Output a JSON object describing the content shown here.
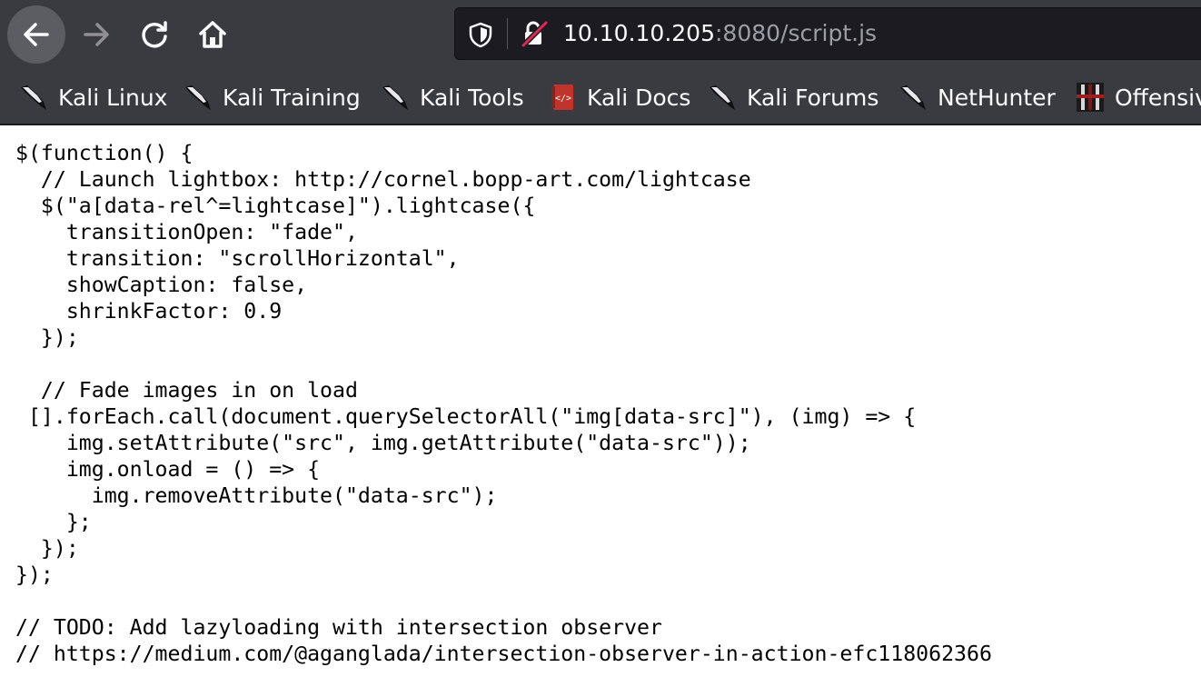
{
  "browser": {
    "url": {
      "host": "10.10.10.205",
      "rest": ":8080/script.js"
    },
    "icons": {
      "back": "arrow-left-icon",
      "forward": "arrow-right-icon",
      "reload": "reload-icon",
      "home": "home-icon",
      "tracking": "shield-icon",
      "insecure": "insecure-lock-icon"
    }
  },
  "bookmarks": [
    {
      "label": "Kali Linux",
      "icon": "kali-dragon-icon"
    },
    {
      "label": "Kali Training",
      "icon": "kali-dragon-icon"
    },
    {
      "label": "Kali Tools",
      "icon": "kali-dragon-icon"
    },
    {
      "label": "Kali Docs",
      "icon": "kali-docs-icon"
    },
    {
      "label": "Kali Forums",
      "icon": "kali-dragon-icon"
    },
    {
      "label": "NetHunter",
      "icon": "kali-dragon-icon"
    },
    {
      "label": "Offensive Security",
      "icon": "offsec-icon"
    }
  ],
  "code_lines": [
    "$(function() {",
    "  // Launch lightbox: http://cornel.bopp-art.com/lightcase",
    "  $(\"a[data-rel^=lightcase]\").lightcase({",
    "    transitionOpen: \"fade\",",
    "    transition: \"scrollHorizontal\",",
    "    showCaption: false,",
    "    shrinkFactor: 0.9",
    "  });",
    "",
    "  // Fade images in on load",
    " [].forEach.call(document.querySelectorAll(\"img[data-src]\"), (img) => {",
    "    img.setAttribute(\"src\", img.getAttribute(\"data-src\"));",
    "    img.onload = () => {",
    "      img.removeAttribute(\"data-src\");",
    "    };",
    "  });",
    "});",
    "",
    "// TODO: Add lazyloading with intersection observer",
    "// https://medium.com/@aganglada/intersection-observer-in-action-efc118062366"
  ],
  "colors": {
    "toolbar": "#3a3a41",
    "urlbar": "#1c1b22",
    "active_button": "#5c5c63",
    "text_light": "#fbfbfe",
    "text_dim": "#9e9ea6",
    "insecure_red": "#e22850"
  }
}
